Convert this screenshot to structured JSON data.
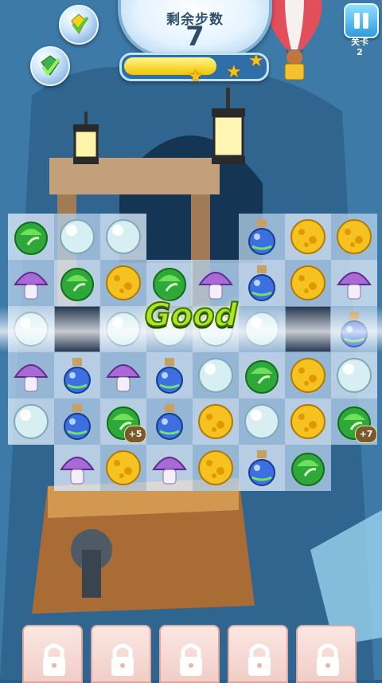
{
  "hud": {
    "moves_label": "剩余步数",
    "moves_value": "7",
    "progress_fraction": 0.66,
    "stars_earned": 3,
    "level_label": "关卡",
    "level_value": "2"
  },
  "feedback": {
    "text": "Good"
  },
  "colors": {
    "accent": "#2f9bdc",
    "good_text": "#a9e81c",
    "star": "#f7c21a"
  },
  "board": {
    "columns": 8,
    "rows": 6,
    "grid": [
      [
        "leaf",
        "pearl",
        "pearl",
        null,
        null,
        "potion",
        "cheese",
        "cheese"
      ],
      [
        "mushroom",
        "leaf",
        "cheese",
        "leaf",
        "mushroom",
        "potion",
        "cheese",
        "mushroom"
      ],
      [
        "pearl",
        "blocked",
        "pearl",
        "pearl",
        "pearl",
        "pearl",
        "blocked",
        "potion"
      ],
      [
        "mushroom",
        "potion",
        "mushroom",
        "potion",
        "pearl",
        "leaf",
        "cheese",
        "pearl"
      ],
      [
        "pearl",
        "potion",
        "leaf",
        "potion",
        "cheese",
        "pearl",
        "cheese",
        "leaf"
      ],
      [
        null,
        "mushroom",
        "cheese",
        "mushroom",
        "cheese",
        "potion",
        "leaf",
        null
      ]
    ],
    "bonuses": [
      {
        "row": 4,
        "col": 2,
        "text": "+5"
      },
      {
        "row": 4,
        "col": 7,
        "text": "+7"
      }
    ]
  },
  "boosters": [
    "gem-booster-icon",
    "bomb-booster-icon"
  ],
  "locked_slots": 5
}
